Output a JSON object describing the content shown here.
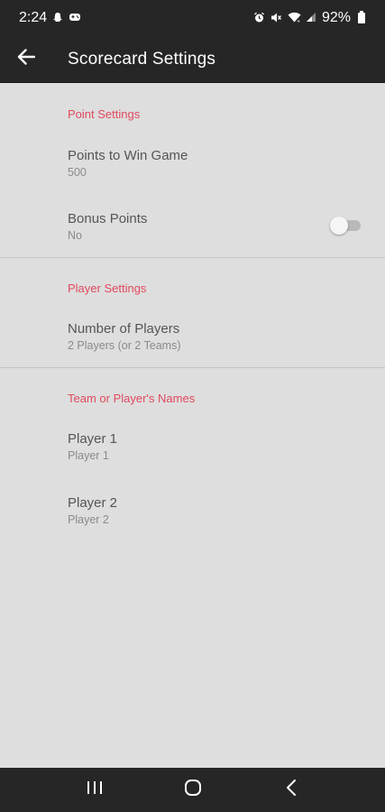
{
  "status_bar": {
    "time": "2:24",
    "battery": "92%",
    "left_icons": [
      "snapchat-icon",
      "gamepad-icon"
    ],
    "right_icons": [
      "alarm-icon",
      "mute-icon",
      "wifi-icon",
      "signal-icon",
      "battery-icon"
    ]
  },
  "app_bar": {
    "title": "Scorecard Settings",
    "back_icon": "back-arrow-icon"
  },
  "sections": {
    "point_settings": {
      "header": "Point Settings",
      "points_to_win": {
        "title": "Points to Win Game",
        "summary": "500"
      },
      "bonus_points": {
        "title": "Bonus Points",
        "summary": "No",
        "enabled": false
      }
    },
    "player_settings": {
      "header": "Player Settings",
      "number_of_players": {
        "title": "Number of Players",
        "summary": "2 Players (or 2 Teams)"
      }
    },
    "names": {
      "header": "Team or Player's Names",
      "player1": {
        "title": "Player 1",
        "summary": "Player 1"
      },
      "player2": {
        "title": "Player 2",
        "summary": "Player 2"
      }
    }
  },
  "colors": {
    "accent": "#e04a5e",
    "bar": "#262626",
    "background": "#dedede"
  },
  "nav_bar": {
    "icons": [
      "recents-icon",
      "home-icon",
      "back-icon"
    ]
  }
}
